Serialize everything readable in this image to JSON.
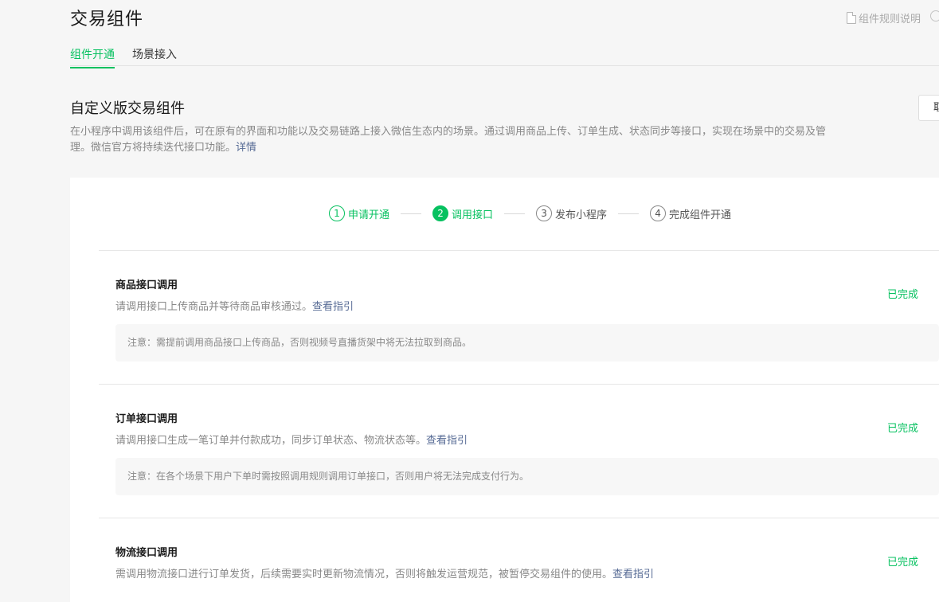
{
  "header": {
    "title": "交易组件",
    "rules_link": "组件规则说明",
    "icons": {
      "rules": "document-icon",
      "help": "help-icon"
    }
  },
  "tabs": [
    {
      "label": "组件开通",
      "active": true
    },
    {
      "label": "场景接入",
      "active": false
    }
  ],
  "section": {
    "title": "自定义版交易组件",
    "description": "在小程序中调用该组件后，可在原有的界面和功能以及交易链路上接入微信生态内的场景。通过调用商品上传、订单生成、状态同步等接口，实现在场景中的交易及管理。微信官方将持续迭代接口功能。",
    "details_link": "详情",
    "right_button": "取"
  },
  "steps": [
    {
      "num": "1",
      "label": "申请开通",
      "state": "done"
    },
    {
      "num": "2",
      "label": "调用接口",
      "state": "current"
    },
    {
      "num": "3",
      "label": "发布小程序",
      "state": "todo"
    },
    {
      "num": "4",
      "label": "完成组件开通",
      "state": "todo"
    }
  ],
  "items": [
    {
      "title": "商品接口调用",
      "desc": "请调用接口上传商品并等待商品审核通过。",
      "guide_link": "查看指引",
      "note": "注意：需提前调用商品接口上传商品，否则视频号直播货架中将无法拉取到商品。",
      "status": "已完成"
    },
    {
      "title": "订单接口调用",
      "desc": "请调用接口生成一笔订单并付款成功，同步订单状态、物流状态等。",
      "guide_link": "查看指引",
      "note": "注意：在各个场景下用户下单时需按照调用规则调用订单接口，否则用户将无法完成支付行为。",
      "status": "已完成"
    },
    {
      "title": "物流接口调用",
      "desc": "需调用物流接口进行订单发货，后续需要实时更新物流情况，否则将触发运营规范，被暂停交易组件的使用。",
      "guide_link": "查看指引",
      "status": "已完成"
    }
  ],
  "colors": {
    "accent": "#07c160",
    "link": "#576b95",
    "muted": "#888888"
  }
}
